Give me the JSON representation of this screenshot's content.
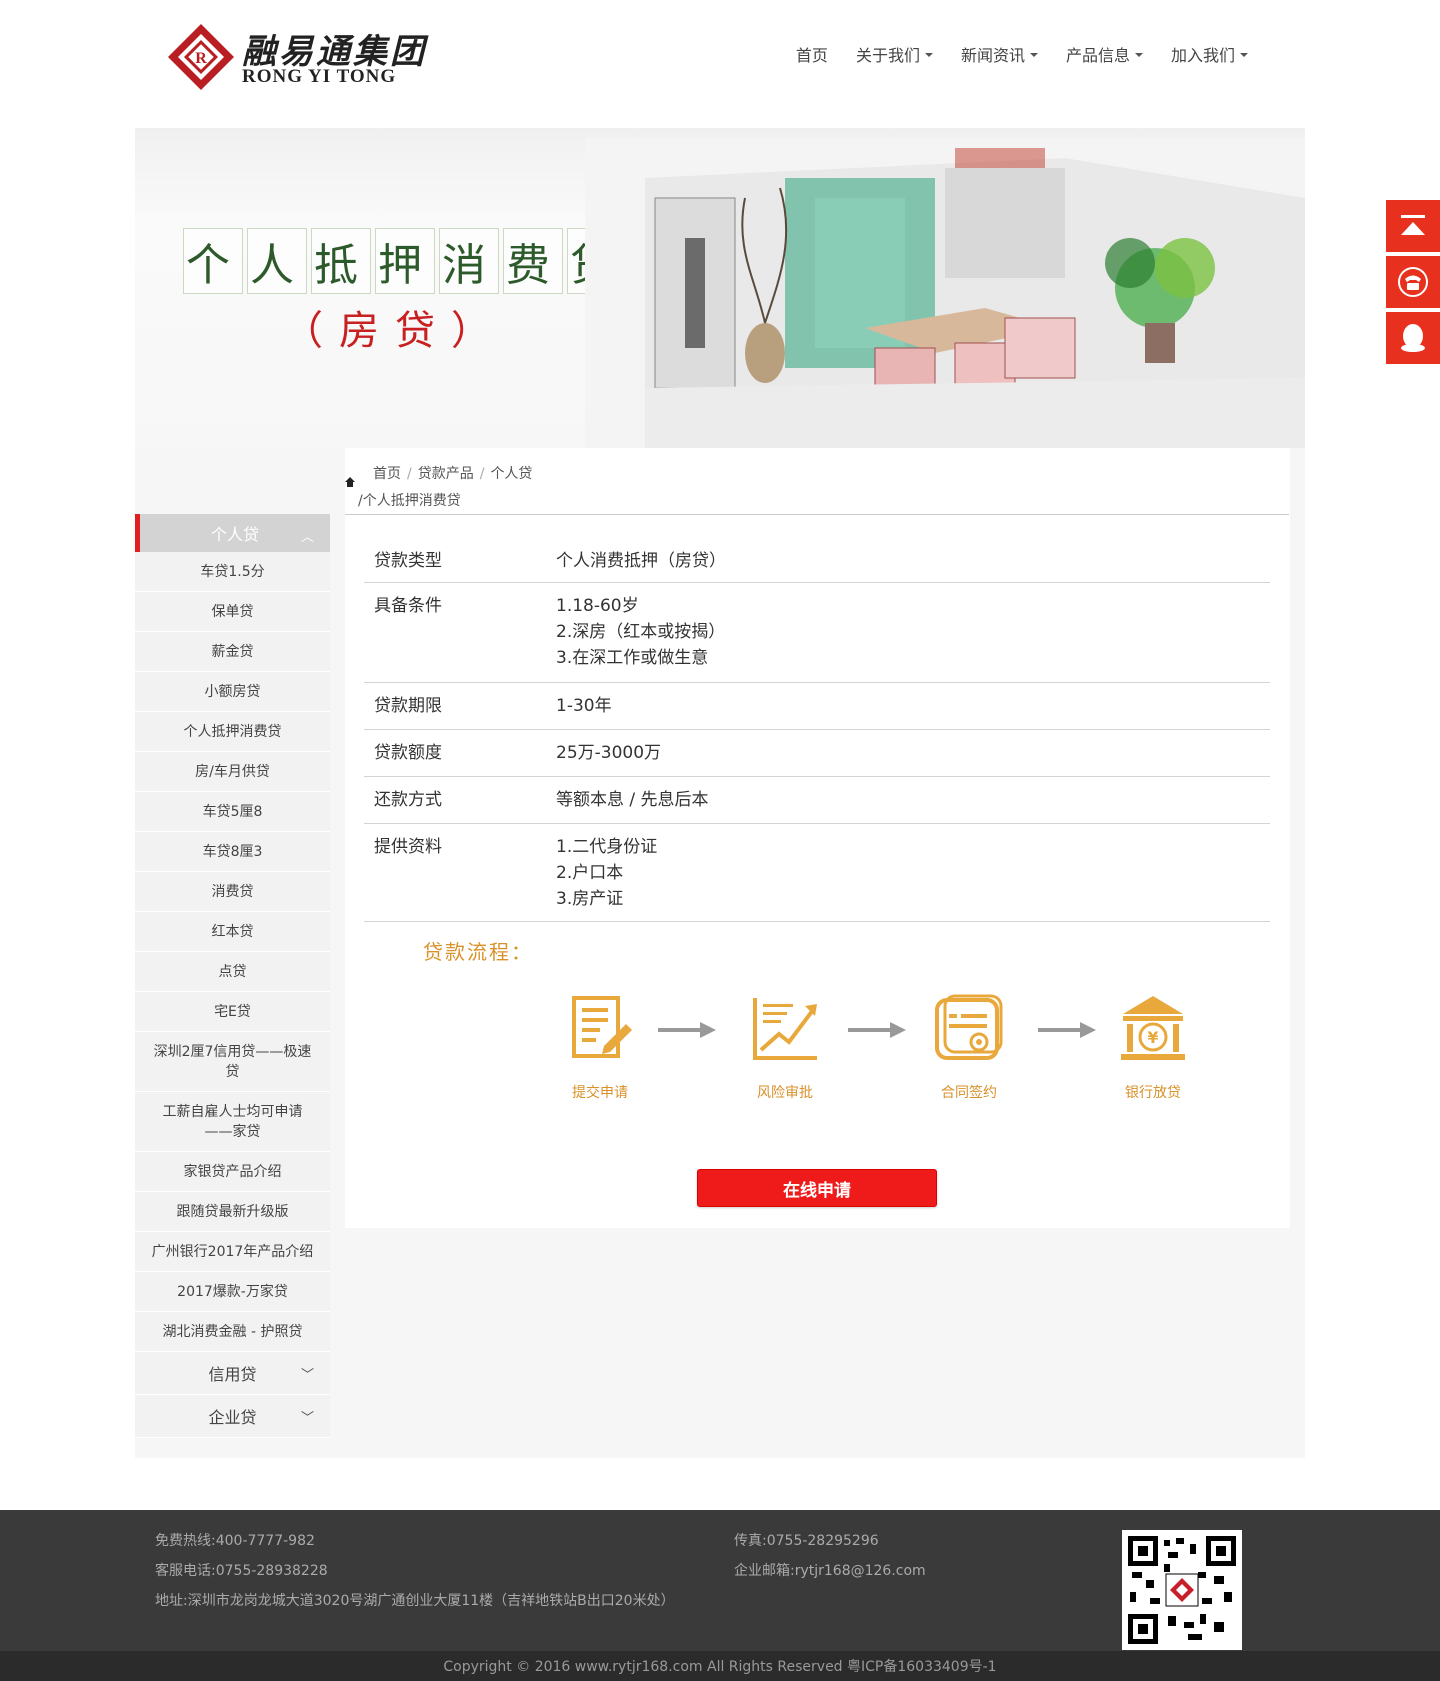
{
  "header": {
    "logo_cn": "融易通集团",
    "logo_en": "RONG YI TONG",
    "nav": [
      {
        "label": "首页",
        "dropdown": false
      },
      {
        "label": "关于我们",
        "dropdown": true
      },
      {
        "label": "新闻资讯",
        "dropdown": true
      },
      {
        "label": "产品信息",
        "dropdown": true
      },
      {
        "label": "加入我们",
        "dropdown": true
      }
    ]
  },
  "banner": {
    "title_chars": [
      "个",
      "人",
      "抵",
      "押",
      "消",
      "费",
      "贷"
    ],
    "subtitle": "（房贷）"
  },
  "float_buttons": [
    "back-to-top-icon",
    "phone-icon",
    "qq-icon"
  ],
  "breadcrumb": {
    "home_icon": "home-icon",
    "items": [
      "首页",
      "贷款产品",
      "个人贷"
    ],
    "current": "/个人抵押消费贷"
  },
  "sidebar": {
    "active_group": "个人贷",
    "items": [
      "车贷1.5分",
      "保单贷",
      "薪金贷",
      "小额房贷",
      "个人抵押消费贷",
      "房/车月供贷",
      "车贷5厘8",
      "车贷8厘3",
      "消费贷",
      "红本贷",
      "点贷",
      "宅E贷",
      "深圳2厘7信用贷——极速贷",
      "工薪自雇人士均可申请——家贷",
      "家银贷产品介绍",
      "跟随贷最新升级版",
      "广州银行2017年产品介绍",
      "2017爆款-万家贷",
      "湖北消费金融 - 护照贷"
    ],
    "groups": [
      "信用贷",
      "企业贷"
    ]
  },
  "info": {
    "rows": [
      {
        "key": "贷款类型",
        "values": [
          "个人消费抵押（房贷）"
        ]
      },
      {
        "key": "具备条件",
        "values": [
          "1.18-60岁",
          "2.深房（红本或按揭）",
          "3.在深工作或做生意"
        ]
      },
      {
        "key": "贷款期限",
        "values": [
          "1-30年"
        ]
      },
      {
        "key": "贷款额度",
        "values": [
          "25万-3000万"
        ]
      },
      {
        "key": "还款方式",
        "values": [
          "等额本息 / 先息后本"
        ]
      },
      {
        "key": "提供资料",
        "values": [
          "1.二代身份证",
          "2.户口本",
          "3.房产证"
        ]
      }
    ]
  },
  "process": {
    "title": "贷款流程：",
    "steps": [
      {
        "label": "提交申请",
        "icon": "application-form-icon"
      },
      {
        "label": "风险审批",
        "icon": "risk-chart-icon"
      },
      {
        "label": "合同签约",
        "icon": "contract-icon"
      },
      {
        "label": "银行放贷",
        "icon": "bank-icon"
      }
    ],
    "accent": "#d9912a"
  },
  "apply_button": "在线申请",
  "footer": {
    "hotline": "免费热线:400-7777-982",
    "service": "客服电话:0755-28938228",
    "address": "地址:深圳市龙岗龙城大道3020号湖广通创业大厦11楼（吉祥地铁站B出口20米处）",
    "fax": "传真:0755-28295296",
    "email": "企业邮箱:rytjr168@126.com",
    "copyright": "Copyright © 2016 www.rytjr168.com All Rights Reserved 粤ICP备16033409号-1"
  },
  "colors": {
    "brand_red": "#c8202a",
    "accent_orange": "#d9912a",
    "button_red": "#ef1a1a",
    "footer_bg": "#3a3a3a"
  }
}
